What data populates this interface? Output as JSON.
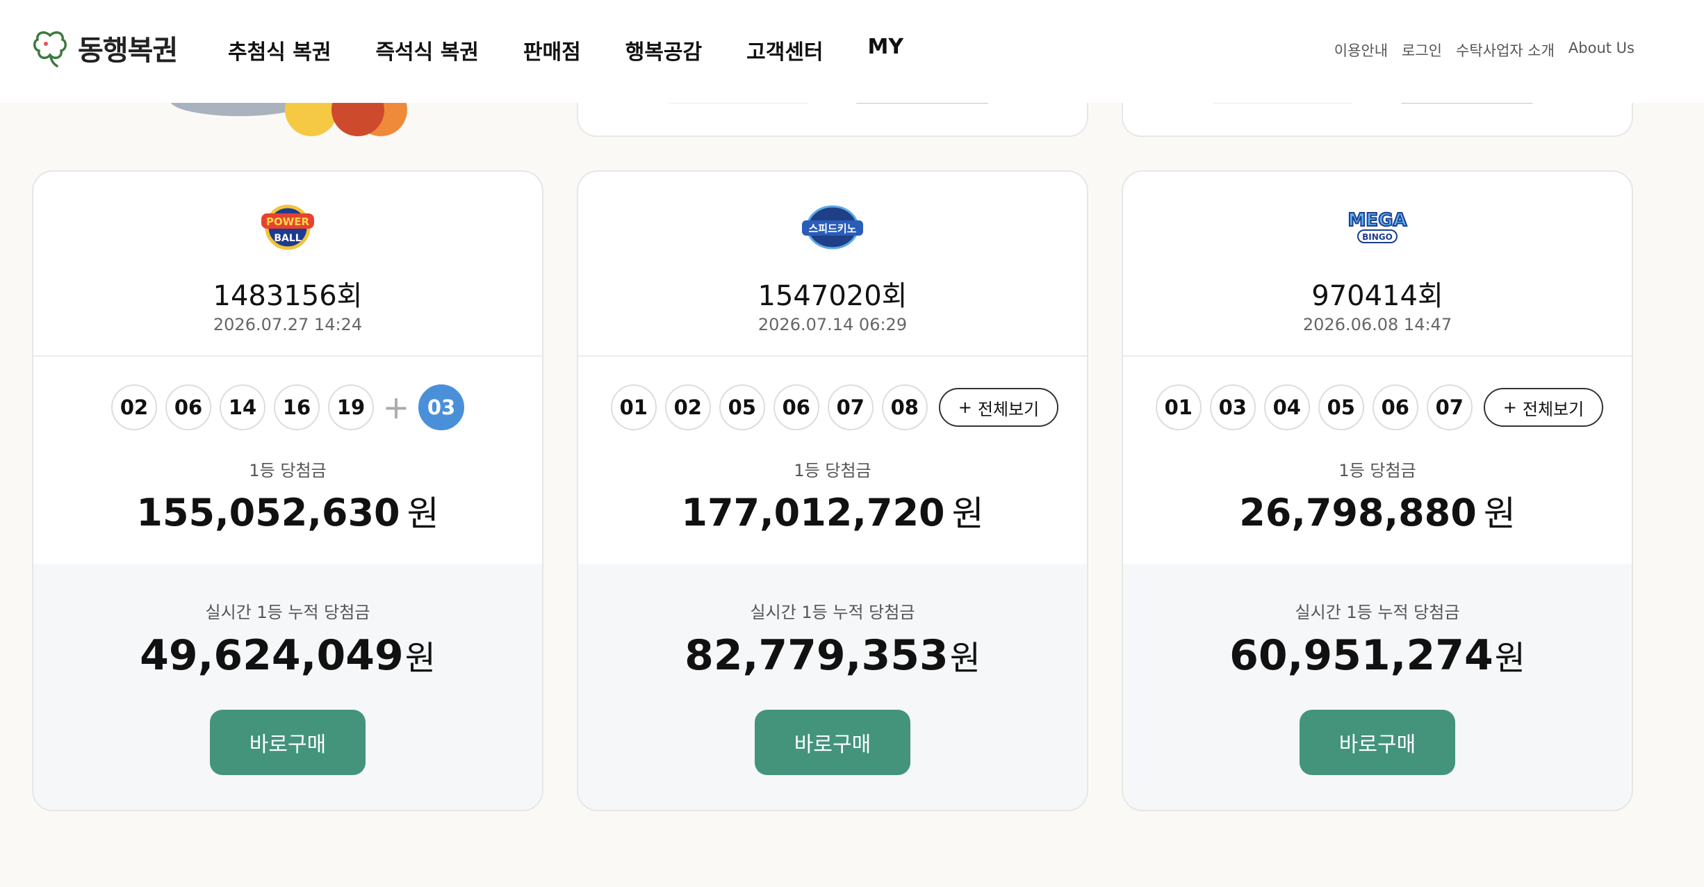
{
  "brand": {
    "name": "동행복권",
    "accent": "#43947b"
  },
  "gnb": [
    "추첨식 복권",
    "즉석식 복권",
    "판매점",
    "행복공감",
    "고객센터",
    "MY"
  ],
  "util": [
    "이용안내",
    "로그인",
    "수탁사업자 소개",
    "About Us"
  ],
  "cards": [
    {
      "logo_icon": "powerball-logo-icon",
      "round": "1483156회",
      "date": "2026.07.27 14:24",
      "balls": [
        "02",
        "06",
        "14",
        "16",
        "19"
      ],
      "bonus": "03",
      "plus": "+",
      "prize_label": "1등 당첨금",
      "prize": "155,052,630",
      "prize_unit": "원",
      "acc_label": "실시간 1등 누적 당첨금",
      "acc": "49,624,049",
      "acc_unit": "원",
      "buy": "바로구매"
    },
    {
      "logo_icon": "speedkeno-logo-icon",
      "round": "1547020회",
      "date": "2026.07.14 06:29",
      "balls": [
        "01",
        "02",
        "05",
        "06",
        "07",
        "08"
      ],
      "more": "전체보기",
      "prize_label": "1등 당첨금",
      "prize": "177,012,720",
      "prize_unit": "원",
      "acc_label": "실시간 1등 누적 당첨금",
      "acc": "82,779,353",
      "acc_unit": "원",
      "buy": "바로구매"
    },
    {
      "logo_icon": "megabingo-logo-icon",
      "round": "970414회",
      "date": "2026.06.08 14:47",
      "balls": [
        "01",
        "03",
        "04",
        "05",
        "06",
        "07"
      ],
      "more": "전체보기",
      "prize_label": "1등 당첨금",
      "prize": "26,798,880",
      "prize_unit": "원",
      "acc_label": "실시간 1등 누적 당첨금",
      "acc": "60,951,274",
      "acc_unit": "원",
      "buy": "바로구매"
    }
  ]
}
